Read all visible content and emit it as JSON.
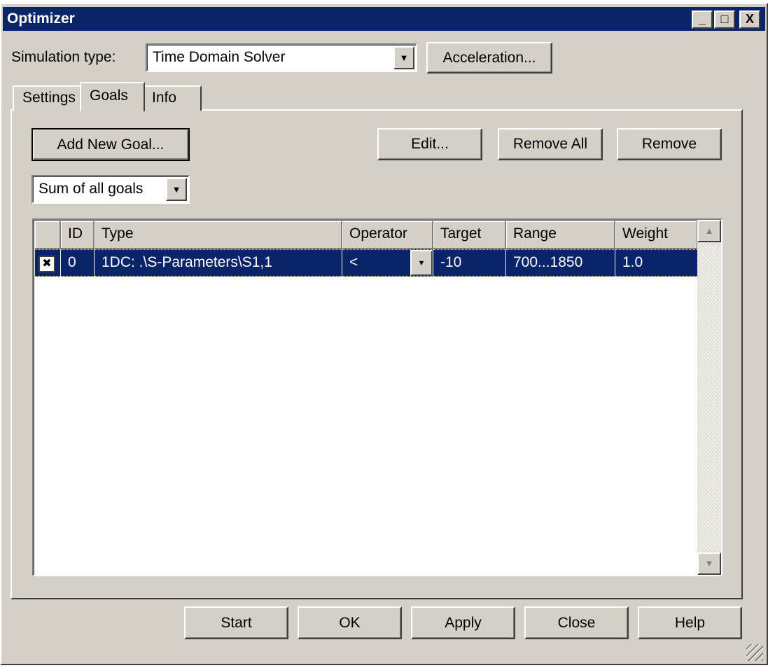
{
  "window": {
    "title": "Optimizer",
    "minimize": "_",
    "maximize": "□",
    "close": "X"
  },
  "simulation": {
    "label": "Simulation type:",
    "value": "Time Domain Solver",
    "acceleration": "Acceleration..."
  },
  "tabs": [
    {
      "label": "Settings"
    },
    {
      "label": "Goals"
    },
    {
      "label": "Info"
    }
  ],
  "goals": {
    "add": "Add New Goal...",
    "edit": "Edit...",
    "remove_all": "Remove All",
    "remove": "Remove",
    "combine": "Sum of all goals"
  },
  "table": {
    "headers": [
      "",
      "ID",
      "Type",
      "Operator",
      "Target",
      "Range",
      "Weight"
    ],
    "rows": [
      {
        "checked": "✖",
        "id": "0",
        "type": "1DC: .\\S-Parameters\\S1,1",
        "operator": "<",
        "target": "-10",
        "range": "700...1850",
        "weight": "1.0"
      }
    ]
  },
  "footer": {
    "start": "Start",
    "ok": "OK",
    "apply": "Apply",
    "close": "Close",
    "help": "Help"
  }
}
